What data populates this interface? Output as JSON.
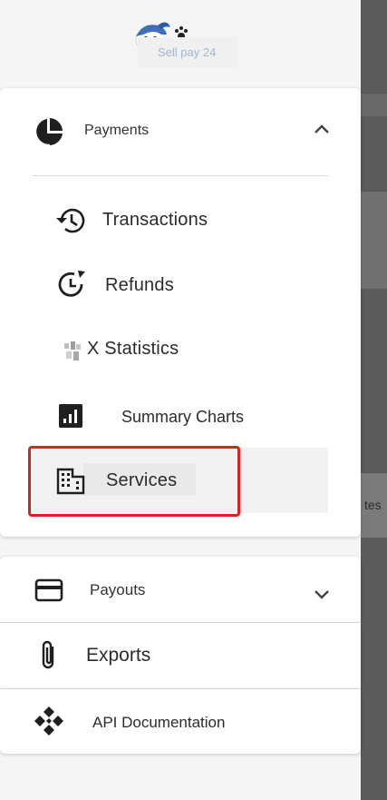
{
  "logo": {
    "text": "Sell pay 24"
  },
  "payments": {
    "label": "Payments",
    "items": [
      {
        "label": "Transactions",
        "icon": "history-icon"
      },
      {
        "label": "Refunds",
        "icon": "refund-clock-icon"
      },
      {
        "label": "X Statistics",
        "icon": "statistics-icon"
      },
      {
        "label": "Summary Charts",
        "icon": "bar-chart-icon"
      },
      {
        "label": "Services",
        "icon": "building-icon"
      }
    ]
  },
  "payouts": {
    "label": "Payouts"
  },
  "exports": {
    "label": "Exports"
  },
  "api": {
    "label": "API Documentation"
  },
  "background": {
    "partial_text": "tes"
  },
  "colors": {
    "highlight": "#e0201f",
    "drawer_bg": "#f5f5f5",
    "card_bg": "#ffffff"
  }
}
